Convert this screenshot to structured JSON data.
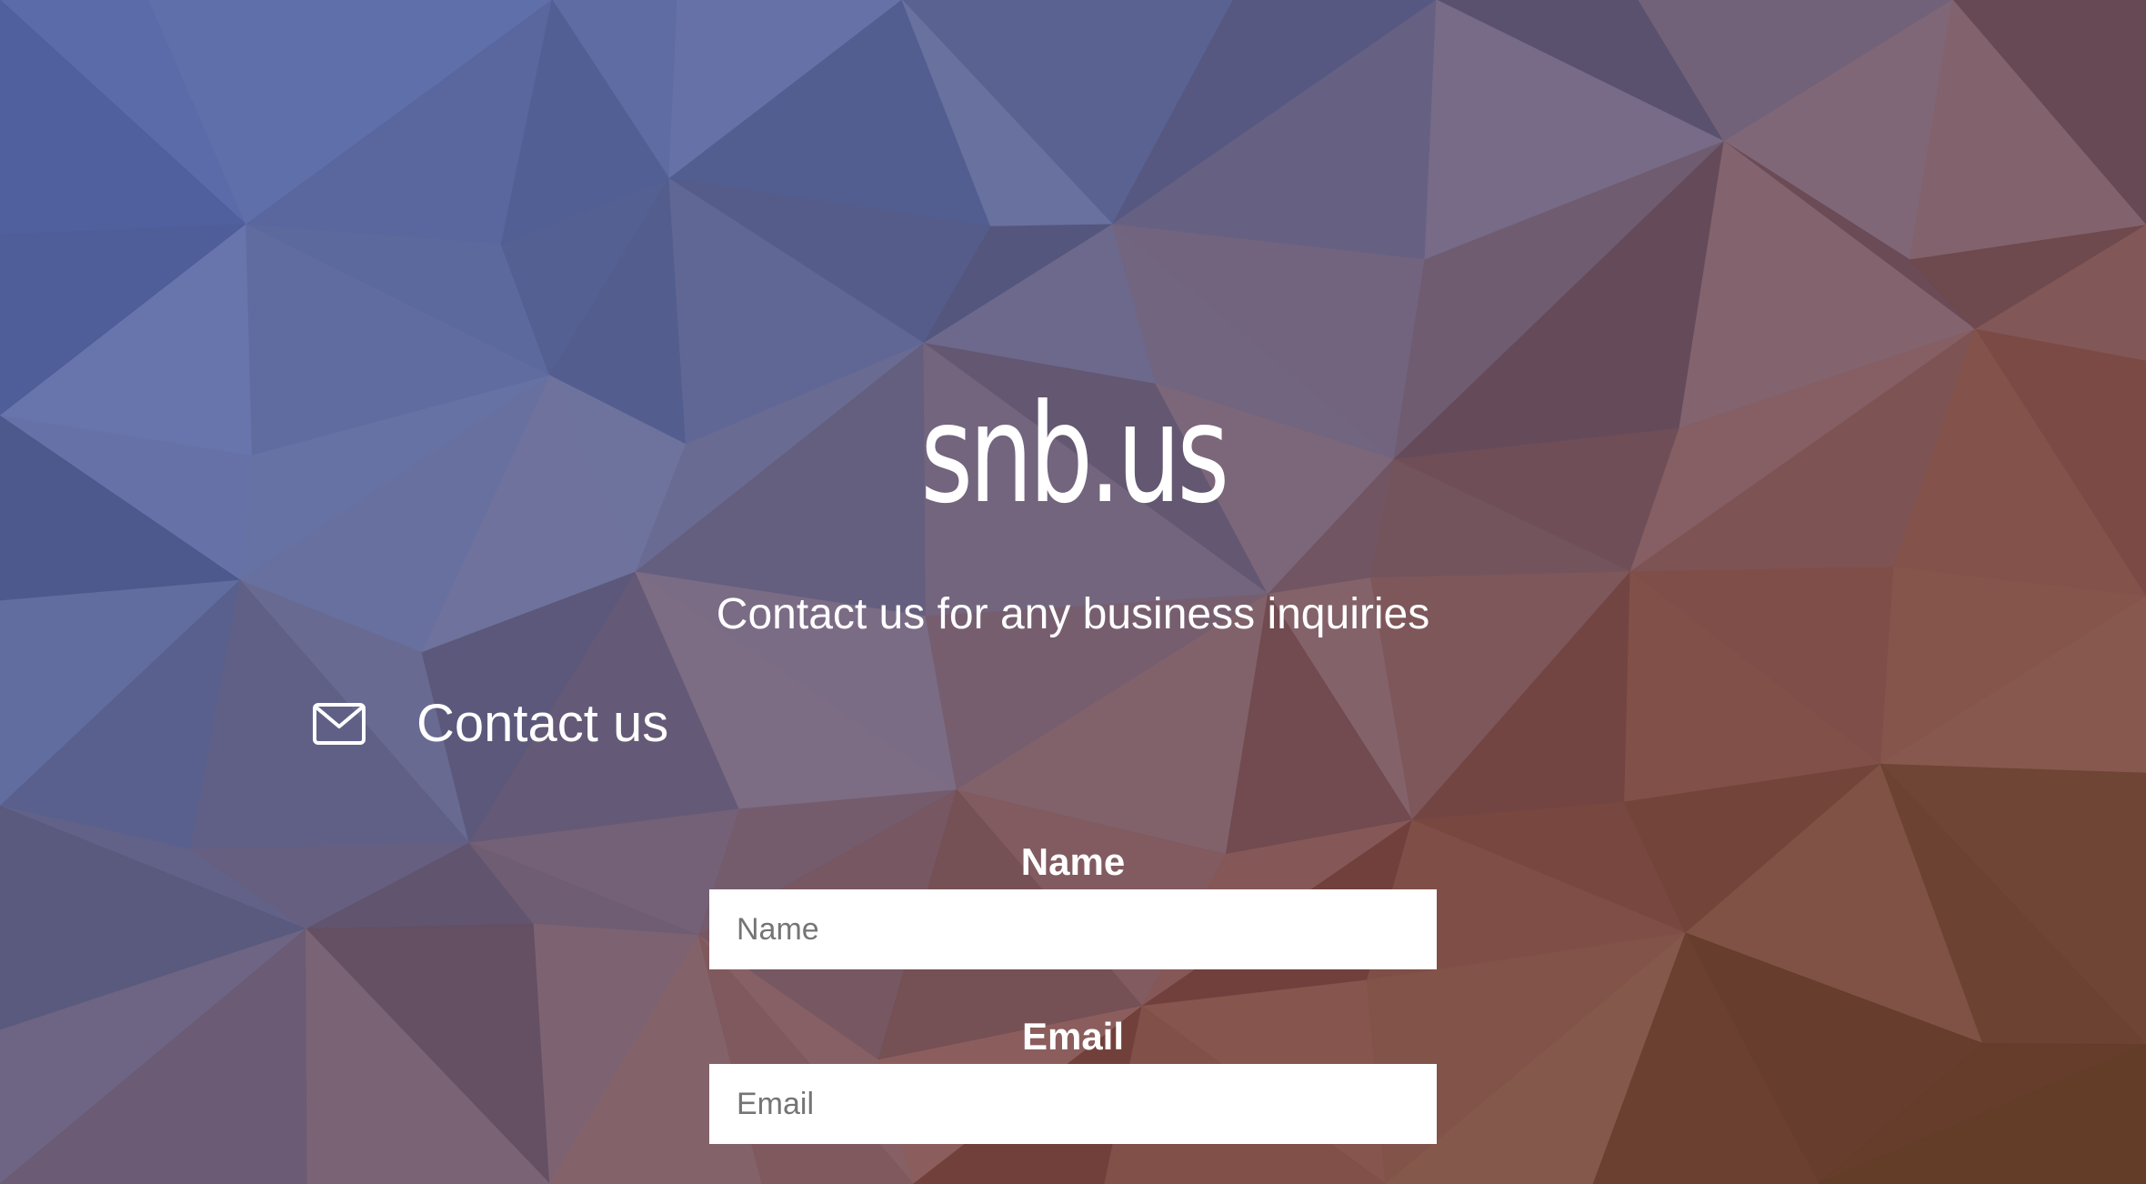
{
  "site": {
    "title": "snb.us",
    "tagline": "Contact us for any business inquiries"
  },
  "contact": {
    "icon": "envelope-icon",
    "heading": "Contact us"
  },
  "form": {
    "name": {
      "label": "Name",
      "placeholder": "Name",
      "value": ""
    },
    "email": {
      "label": "Email",
      "placeholder": "Email",
      "value": ""
    }
  },
  "theme": {
    "text": "#ffffff",
    "input_background": "#ffffff",
    "placeholder": "#757575",
    "background_style": "low-poly triangles, blue-purple top-left fading to brown-orange bottom-right"
  }
}
